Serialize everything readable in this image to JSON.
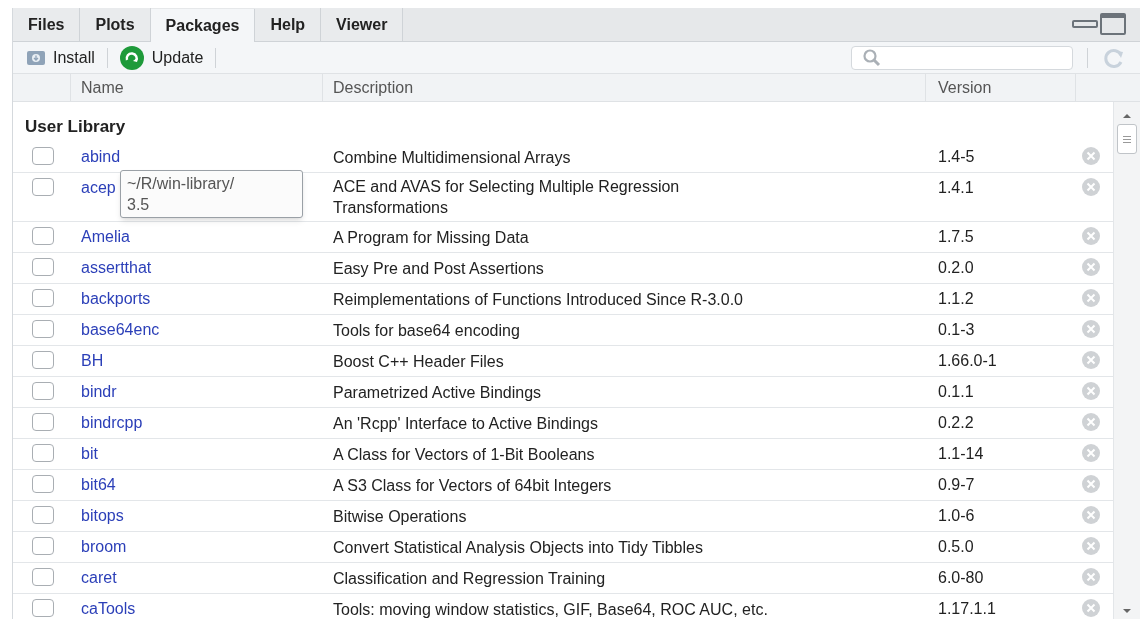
{
  "tabs": [
    {
      "label": "Files",
      "selected": false
    },
    {
      "label": "Plots",
      "selected": false
    },
    {
      "label": "Packages",
      "selected": true
    },
    {
      "label": "Help",
      "selected": false
    },
    {
      "label": "Viewer",
      "selected": false
    }
  ],
  "toolbar": {
    "buttons": [
      {
        "label": "Install",
        "kind": "install"
      },
      {
        "label": "Update",
        "kind": "update"
      }
    ]
  },
  "table": {
    "columns": [
      "Name",
      "Description",
      "Version"
    ],
    "section": "User Library",
    "rows": [
      {
        "checked": false,
        "name": "abind",
        "description": "Combine Multidimensional Arrays",
        "version": "1.4-5"
      },
      {
        "checked": false,
        "name": "acep",
        "description": "ACE and AVAS for Selecting Multiple Regression Transformations",
        "version": "1.4.1"
      },
      {
        "checked": false,
        "name": "Amelia",
        "description": "A Program for Missing Data",
        "version": "1.7.5"
      },
      {
        "checked": false,
        "name": "assertthat",
        "description": "Easy Pre and Post Assertions",
        "version": "0.2.0"
      },
      {
        "checked": false,
        "name": "backports",
        "description": "Reimplementations of Functions Introduced Since R-3.0.0",
        "version": "1.1.2"
      },
      {
        "checked": false,
        "name": "base64enc",
        "description": "Tools for base64 encoding",
        "version": "0.1-3"
      },
      {
        "checked": false,
        "name": "BH",
        "description": "Boost C++ Header Files",
        "version": "1.66.0-1"
      },
      {
        "checked": false,
        "name": "bindr",
        "description": "Parametrized Active Bindings",
        "version": "0.1.1"
      },
      {
        "checked": false,
        "name": "bindrcpp",
        "description": "An 'Rcpp' Interface to Active Bindings",
        "version": "0.2.2"
      },
      {
        "checked": false,
        "name": "bit",
        "description": "A Class for Vectors of 1-Bit Booleans",
        "version": "1.1-14"
      },
      {
        "checked": false,
        "name": "bit64",
        "description": "A S3 Class for Vectors of 64bit Integers",
        "version": "0.9-7"
      },
      {
        "checked": false,
        "name": "bitops",
        "description": "Bitwise Operations",
        "version": "1.0-6"
      },
      {
        "checked": false,
        "name": "broom",
        "description": "Convert Statistical Analysis Objects into Tidy Tibbles",
        "version": "0.5.0"
      },
      {
        "checked": false,
        "name": "caret",
        "description": "Classification and Regression Training",
        "version": "6.0-80"
      },
      {
        "checked": false,
        "name": "caTools",
        "description": "Tools: moving window statistics, GIF, Base64, ROC AUC, etc.",
        "version": "1.17.1.1"
      }
    ]
  },
  "tooltip": {
    "lines": [
      "~/R/win-library/",
      "3.5"
    ]
  }
}
